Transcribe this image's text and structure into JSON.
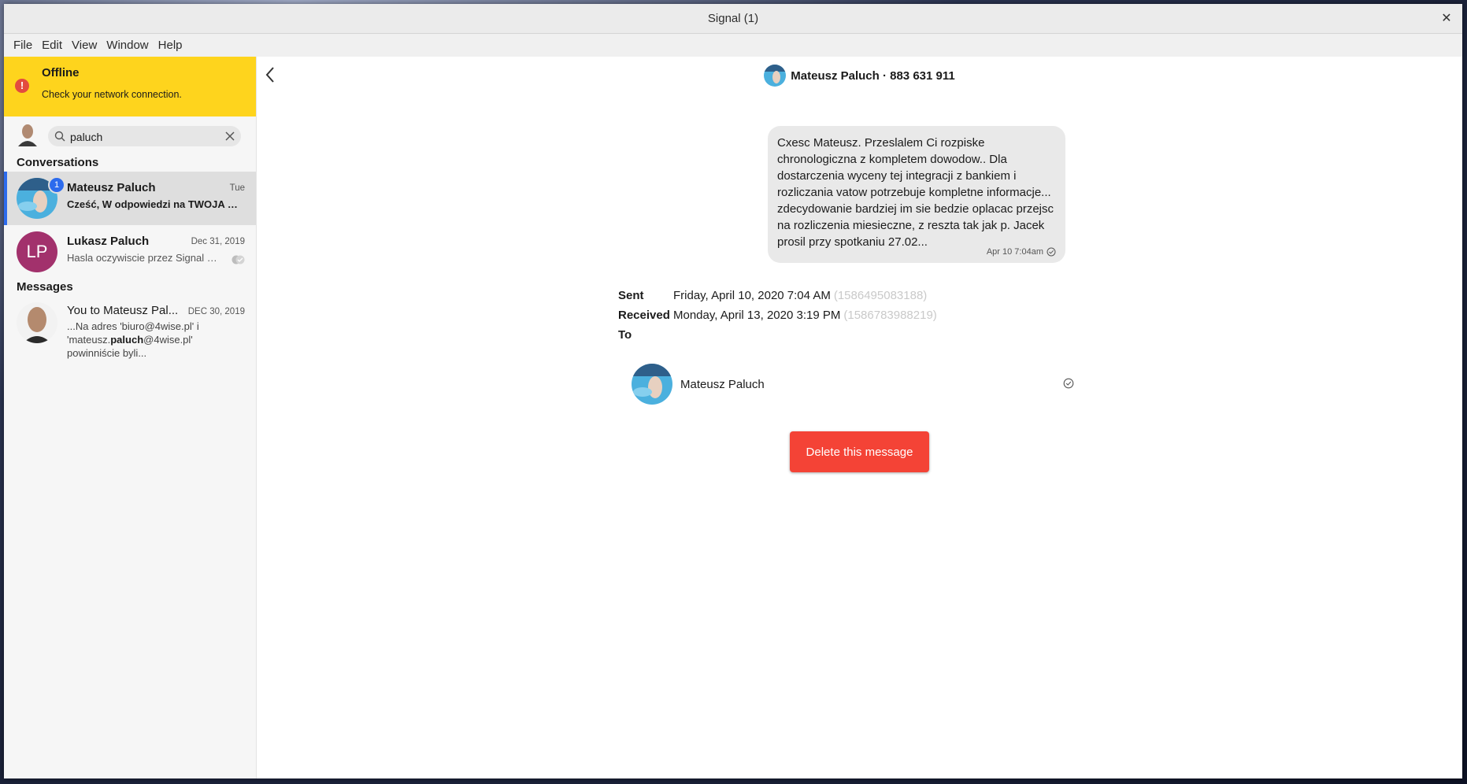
{
  "window": {
    "title": "Signal (1)",
    "close_glyph": "✕"
  },
  "menu": [
    "File",
    "Edit",
    "View",
    "Window",
    "Help"
  ],
  "offline": {
    "title": "Offline",
    "message": "Check your network connection.",
    "icon": "!"
  },
  "search": {
    "value": "paluch",
    "placeholder": "Search"
  },
  "sections": {
    "conversations": "Conversations",
    "messages": "Messages"
  },
  "conversations": [
    {
      "name": "Mateusz Paluch",
      "date": "Tue",
      "preview": "Cześć, W odpowiedzi na TWOJA …",
      "unread": "1",
      "selected": true
    },
    {
      "name": "Lukasz Paluch",
      "initials": "LP",
      "date": "Dec 31, 2019",
      "preview": "Hasla oczywiscie przez Signal …",
      "avatar_color": "#a2316c"
    }
  ],
  "message_results": [
    {
      "title": "You to Mateusz Pal...",
      "date": "DEC 30, 2019",
      "snippet_pre": "...Na adres 'biuro@4wise.pl' i 'mateusz.",
      "snippet_highlight": "paluch",
      "snippet_post": "@4wise.pl' powinniście byli..."
    }
  ],
  "conversation_header": {
    "title": "Mateusz Paluch · 883 631 911"
  },
  "message": {
    "text": "Cxesc Mateusz. Przeslalem Ci rozpiske chronologiczna z kompletem dowodow.. Dla dostarczenia wyceny tej integracji z bankiem i rozliczania vatow potrzebuje kompletne informacje... zdecydowanie bardziej im sie bedzie oplacac przejsc na rozliczenia miesieczne, z reszta tak jak p. Jacek prosil przy spotkaniu 27.02...",
    "timestamp": "Apr 10 7:04am"
  },
  "details": {
    "sent_label": "Sent",
    "sent_value": "Friday, April 10, 2020 7:04 AM",
    "sent_ts": "(1586495083188)",
    "received_label": "Received",
    "received_value": "Monday, April 13, 2020 3:19 PM",
    "received_ts": "(1586783988219)",
    "to_label": "To"
  },
  "recipient": {
    "name": "Mateusz Paluch"
  },
  "delete_button": "Delete this message",
  "colors": {
    "accent": "#2c6bed",
    "banner": "#fed41d",
    "danger": "#f44336",
    "lp_avatar": "#a2316c"
  }
}
